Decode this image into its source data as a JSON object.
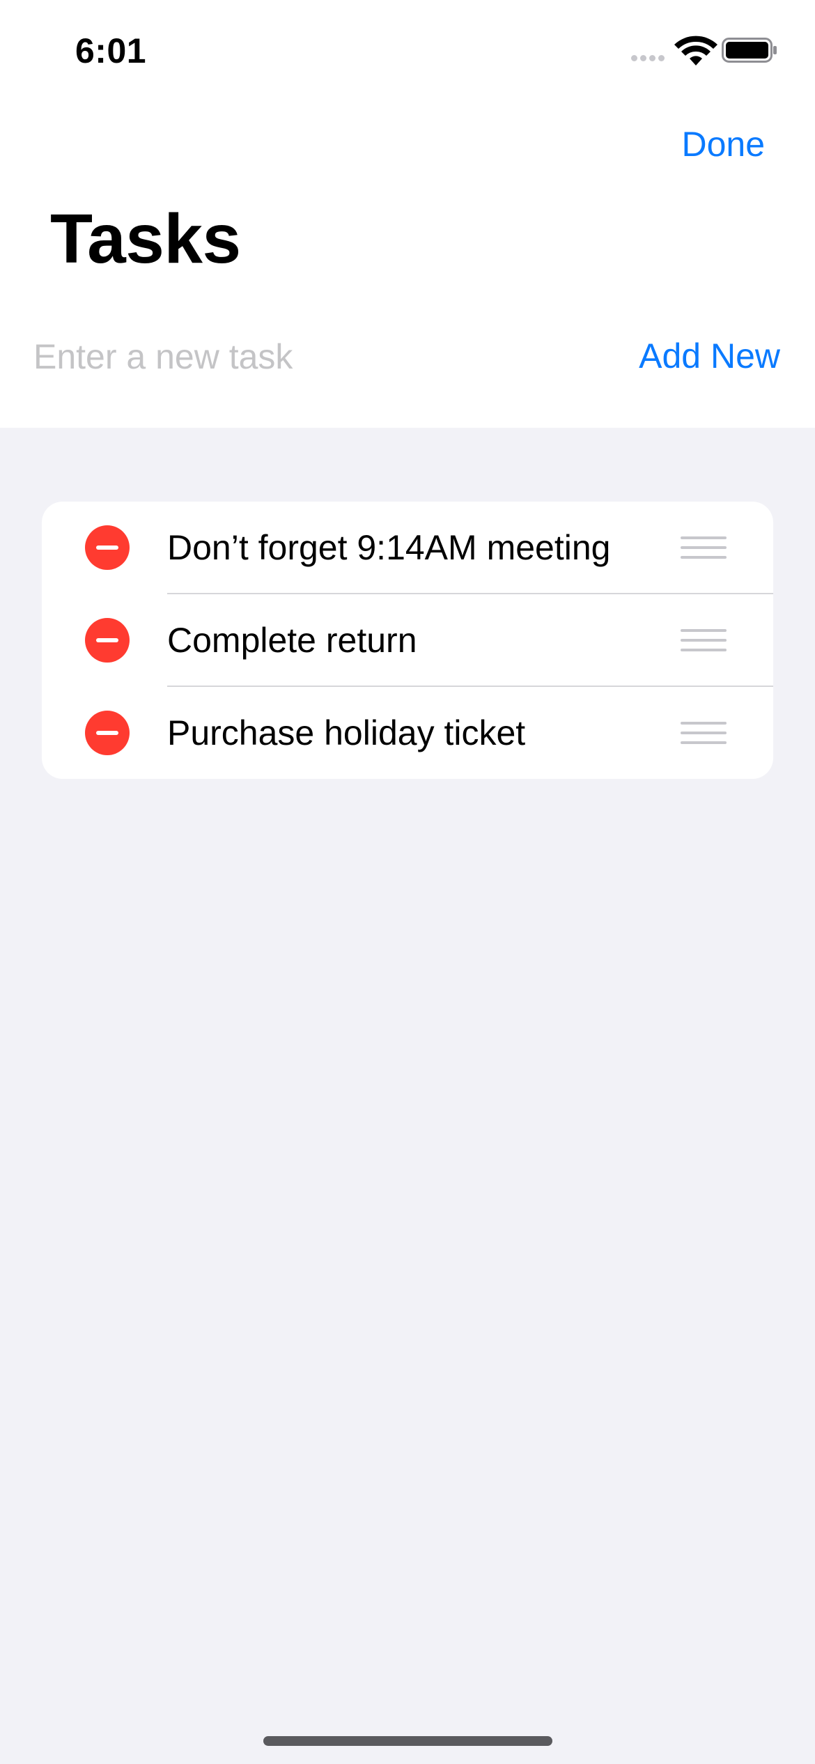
{
  "status_bar": {
    "time": "6:01"
  },
  "nav": {
    "done_label": "Done",
    "title": "Tasks"
  },
  "new_task": {
    "placeholder": "Enter a new task",
    "value": "",
    "add_label": "Add New"
  },
  "tasks": [
    {
      "text": "Don’t forget 9:14AM meeting"
    },
    {
      "text": "Complete return"
    },
    {
      "text": "Purchase holiday ticket"
    }
  ],
  "icons": {
    "delete": "delete-circle-icon",
    "reorder": "reorder-handle-icon",
    "wifi": "wifi-icon",
    "battery": "battery-icon",
    "signal": "cellular-signal-icon"
  },
  "colors": {
    "accent": "#0a7aff",
    "destructive": "#ff3b30",
    "background": "#f2f2f7",
    "card": "#ffffff",
    "placeholder": "#c4c4c6"
  }
}
